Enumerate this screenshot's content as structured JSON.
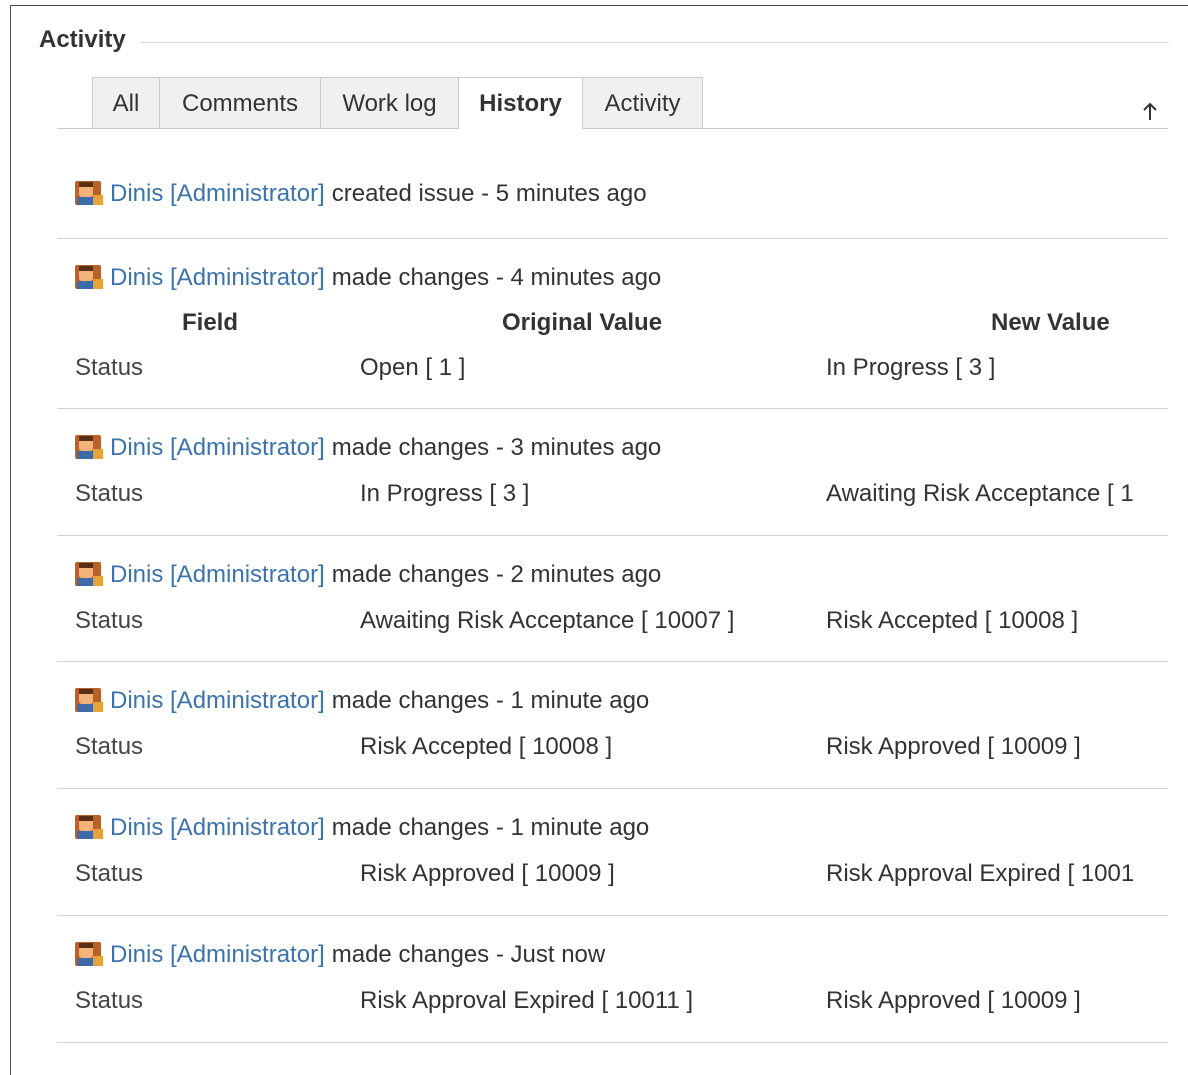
{
  "section": {
    "title": "Activity"
  },
  "tabs": [
    {
      "label": "All",
      "active": false
    },
    {
      "label": "Comments",
      "active": false
    },
    {
      "label": "Work log",
      "active": false
    },
    {
      "label": "History",
      "active": true
    },
    {
      "label": "Activity",
      "active": false
    }
  ],
  "scroll_icon": "arrow-up-icon",
  "table_headers": {
    "field": "Field",
    "original": "Original Value",
    "new": "New Value"
  },
  "history": [
    {
      "user": "Dinis [Administrator]",
      "action": "created issue - 5 minutes ago"
    },
    {
      "user": "Dinis [Administrator]",
      "action": "made changes - 4 minutes ago",
      "change": {
        "field": "Status",
        "original": "Open [ 1 ]",
        "new": "In Progress [ 3 ]"
      }
    },
    {
      "user": "Dinis [Administrator]",
      "action": "made changes - 3 minutes ago",
      "change": {
        "field": "Status",
        "original": "In Progress [ 3 ]",
        "new": "Awaiting Risk Acceptance [ 1"
      }
    },
    {
      "user": "Dinis [Administrator]",
      "action": "made changes - 2 minutes ago",
      "change": {
        "field": "Status",
        "original": "Awaiting Risk Acceptance [ 10007 ]",
        "new": "Risk Accepted [ 10008 ]"
      }
    },
    {
      "user": "Dinis [Administrator]",
      "action": "made changes - 1 minute ago",
      "change": {
        "field": "Status",
        "original": "Risk Accepted [ 10008 ]",
        "new": "Risk Approved [ 10009 ]"
      }
    },
    {
      "user": "Dinis [Administrator]",
      "action": "made changes - 1 minute ago",
      "change": {
        "field": "Status",
        "original": "Risk Approved [ 10009 ]",
        "new": "Risk Approval Expired [ 1001"
      }
    },
    {
      "user": "Dinis [Administrator]",
      "action": "made changes - Just now",
      "change": {
        "field": "Status",
        "original": "Risk Approval Expired [ 10011 ]",
        "new": "Risk Approved [ 10009 ]"
      }
    }
  ],
  "colors": {
    "link": "#3b73af",
    "text": "#333333",
    "divider": "#d2d2d2",
    "tab_bg": "#f0f0f0"
  }
}
